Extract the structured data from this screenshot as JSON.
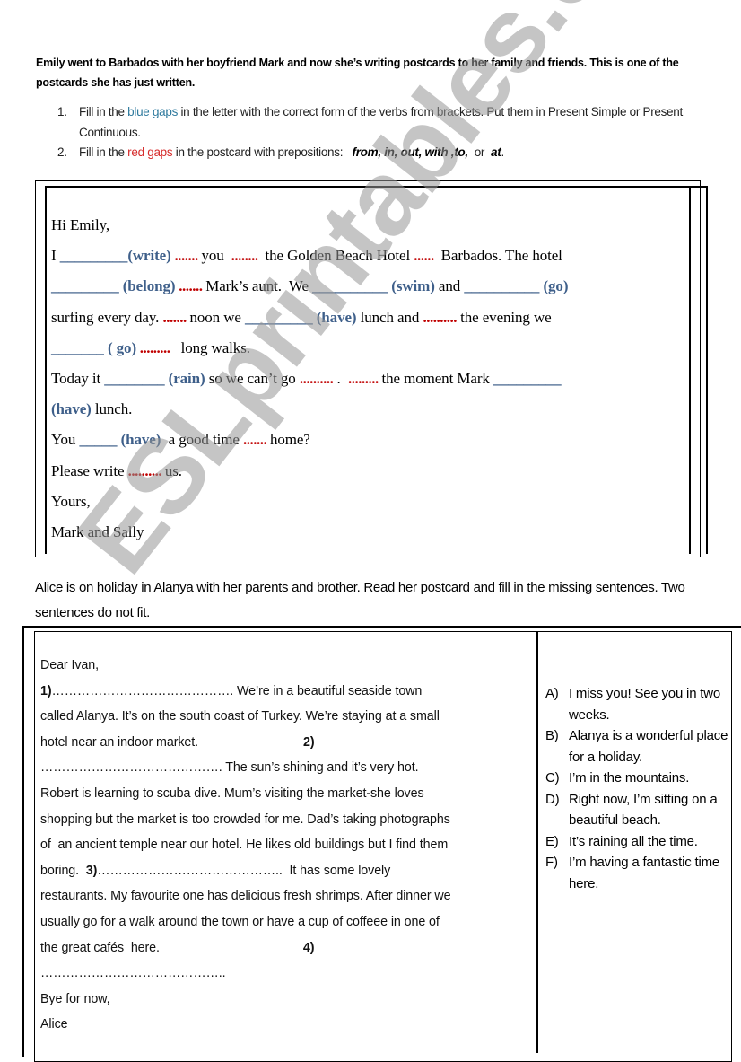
{
  "intro": {
    "text": "Emily went to Barbados with her boyfriend Mark and now she’s writing postcards to her family and friends. This is one of the postcards she has just written."
  },
  "instructions": [
    {
      "num": "1.",
      "before": "Fill in the ",
      "highlight": "blue gaps",
      "after": " in the letter with the correct form of the verbs from brackets. Put them in Present Simple or Present Continuous."
    },
    {
      "num": "2.",
      "before": "Fill in the ",
      "highlight": "red gaps",
      "middle": " in the postcard with prepositions:   ",
      "prepositions": "from, in, out, with ,to,",
      "or": "  or  ",
      "last_prep": "at",
      "end": "."
    }
  ],
  "colors": {
    "blue_gap": "#3e5f8a",
    "red_gap": "#c00000",
    "instruction_blue": "#2f7a9e",
    "instruction_red": "#d62b2b"
  },
  "letter1": {
    "greeting": "Hi Emily,",
    "l1": {
      "a": "I ",
      "gap1": "_________(write)",
      "d1": " ....... ",
      "b": "you ",
      "d2": " ........ ",
      "c": " the Golden Beach Hotel ",
      "d3": "...... ",
      "e": " Barbados. The hotel"
    },
    "l2": {
      "gap1": "_________ (belong)",
      "d1": " ....... ",
      "a": "Mark’s aunt.  We ",
      "gap2": "__________ (swim)",
      "b": " and ",
      "gap3": "__________ (go)"
    },
    "l3": {
      "a": "surfing every day. ",
      "d1": "....... ",
      "b": "noon we ",
      "gap1": "_________ (have)",
      "c": " lunch and ",
      "d2": "..........",
      "e": " the evening we"
    },
    "l4": {
      "gap1": "_______ ( go)",
      "d1": " ......... ",
      "a": "  long walks."
    },
    "l5": {
      "a": "Today it ",
      "gap1": "________ (rain)",
      "b": " so we can’t go ",
      "d1": "..........",
      "c": " .  ",
      "d2": "......... ",
      "e": "the moment Mark ",
      "gap2": "_________"
    },
    "l6": {
      "gap1": "(have)",
      "a": " lunch."
    },
    "l7": {
      "a": "You ",
      "gap1": "_____ (have)",
      "b": "  a good time ",
      "d1": "....... ",
      "c": "home?"
    },
    "l8": {
      "a": "Please write ",
      "d1": ".......... ",
      "b": "us."
    },
    "closing": "Yours,",
    "signature": "Mark and Sally"
  },
  "section2": {
    "intro": "Alice is on holiday in Alanya with her parents and brother. Read her postcard and fill in the missing sentences. Two sentences do not fit."
  },
  "letter2": {
    "greeting": "Dear Ivan,",
    "l1": {
      "num": "1)",
      "dots": "……………………………………. ",
      "text": "We’re in a beautiful seaside town"
    },
    "l2": "called Alanya. It’s on the south coast of Turkey. We’re staying at a small",
    "l3": {
      "text": "hotel near an indoor market.",
      "num": "2)"
    },
    "l4": {
      "dots": "……………………………………. ",
      "text": "The sun’s shining and it’s very hot."
    },
    "l5": "Robert is learning to scuba dive. Mum’s visiting the market-she loves",
    "l6": "shopping but the market is too crowded for me. Dad’s taking photographs",
    "l7": "of  an ancient temple near our hotel. He likes old buildings but I find them",
    "l8": {
      "a": "boring.  ",
      "num": "3)",
      "dots": "……………………………………..",
      "text": "  It has some lovely"
    },
    "l9": "restaurants. My favourite one has delicious fresh shrimps. After dinner we",
    "l10": "usually go for a walk around the town or have a cup of coffeee in one of",
    "l11": {
      "text": "the great cafés  here.",
      "num": "4)"
    },
    "l12": "……………………………………..",
    "closing": "Bye for now,",
    "signature": "Alice"
  },
  "options": [
    {
      "letter": "A)",
      "text": "I miss you! See you in two weeks."
    },
    {
      "letter": "B)",
      "text": "Alanya is a wonderful place for a holiday."
    },
    {
      "letter": "C)",
      "text": "I’m in the mountains."
    },
    {
      "letter": "D)",
      "text": "Right now, I’m sitting on a beautiful beach."
    },
    {
      "letter": "E)",
      "text": "It’s raining all the time."
    },
    {
      "letter": "F)",
      "text": "I’m having a fantastic time here."
    }
  ],
  "watermark": "ESLprintables.com"
}
